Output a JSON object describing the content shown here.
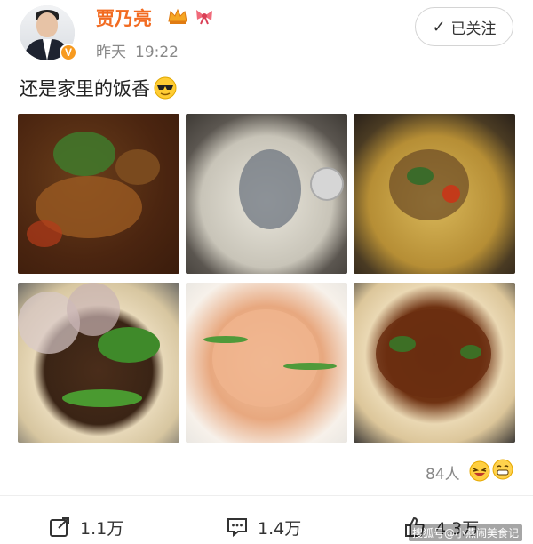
{
  "header": {
    "username": "贾乃亮",
    "time_label": "昨天",
    "time": "19:22",
    "follow_label": "已关注",
    "verified_badge": "V",
    "icons": [
      "crown-icon",
      "bow-icon",
      "verified-badge-icon"
    ]
  },
  "post": {
    "text": "还是家里的饭香",
    "emoji": "sunglasses-emoji",
    "photos": [
      {
        "name": "braised-dish-photo"
      },
      {
        "name": "fish-soup-photo"
      },
      {
        "name": "stir-fry-photo"
      },
      {
        "name": "gloved-cooking-photo"
      },
      {
        "name": "fried-shrimp-photo"
      },
      {
        "name": "saucy-dish-photo"
      }
    ]
  },
  "reactions": {
    "count": "84人",
    "emojis": [
      "laughing-emoji",
      "grin-emoji"
    ]
  },
  "actions": {
    "share_count": "1.1万",
    "comment_count": "1.4万",
    "like_count": "4.3万"
  },
  "watermark": "搜狐号@小燕闹美食记",
  "colors": {
    "username": "#f26b21",
    "verified": "#f79a1f",
    "meta": "#888888"
  }
}
